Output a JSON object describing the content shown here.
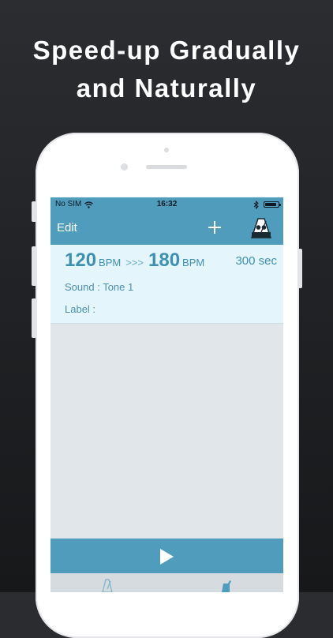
{
  "headline": {
    "line1": "Speed-up Gradually",
    "line2": "and Naturally"
  },
  "status_bar": {
    "carrier": "No SIM",
    "time": "16:32"
  },
  "nav": {
    "edit_label": "Edit"
  },
  "presets": [
    {
      "start_bpm": "120",
      "bpm_unit": "BPM",
      "arrow": ">>>",
      "end_bpm": "180",
      "duration": "300 sec",
      "sound": "Sound : Tone 1",
      "label": "Label :"
    }
  ],
  "colors": {
    "accent": "#4f9cbc",
    "row_background": "#e4f6fc",
    "text_accent": "#3e8fb3",
    "screen_background": "#e0e6ea"
  },
  "icons": {
    "add": "plus-icon",
    "metronome": "metronome-icon",
    "play": "play-icon",
    "wifi": "wifi-icon",
    "bluetooth": "bluetooth-icon",
    "battery": "battery-icon",
    "tab_left": "metronome-tab-icon",
    "tab_right": "speed-trainer-tab-icon"
  }
}
